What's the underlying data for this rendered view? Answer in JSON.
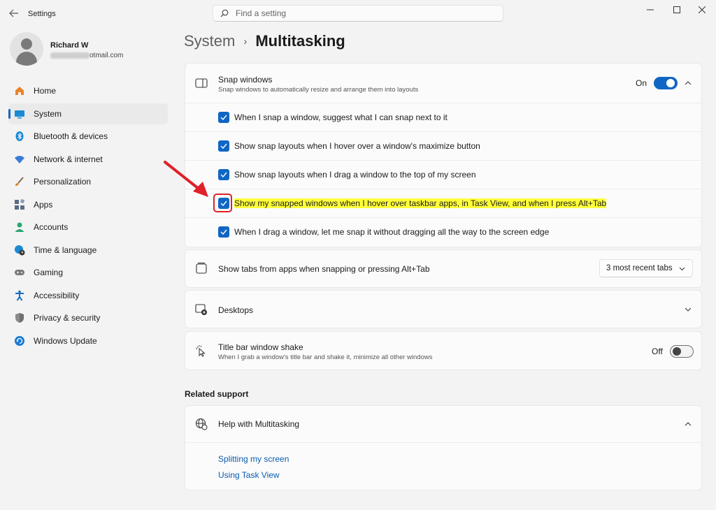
{
  "window": {
    "title": "Settings",
    "back_icon": "back-arrow-icon",
    "controls": [
      "minimize-icon",
      "maximize-icon",
      "close-icon"
    ]
  },
  "search": {
    "placeholder": "Find a setting"
  },
  "profile": {
    "name": "Richard W",
    "email_visible": "otmail.com"
  },
  "sidebar": {
    "items": [
      {
        "label": "Home",
        "icon": "home-icon",
        "color": "#e8832a"
      },
      {
        "label": "System",
        "icon": "system-icon",
        "color": "#1a8ad4",
        "active": true
      },
      {
        "label": "Bluetooth & devices",
        "icon": "bluetooth-icon",
        "color": "#1a8ad4"
      },
      {
        "label": "Network & internet",
        "icon": "wifi-icon",
        "color": "#3a7bd5"
      },
      {
        "label": "Personalization",
        "icon": "brush-icon",
        "color": "#d8822c"
      },
      {
        "label": "Apps",
        "icon": "apps-icon",
        "color": "#5b6b86"
      },
      {
        "label": "Accounts",
        "icon": "accounts-icon",
        "color": "#2aa56f"
      },
      {
        "label": "Time & language",
        "icon": "globe-clock-icon",
        "color": "#1a8ad4"
      },
      {
        "label": "Gaming",
        "icon": "gamepad-icon",
        "color": "#7a7a7a"
      },
      {
        "label": "Accessibility",
        "icon": "accessibility-icon",
        "color": "#1a6fc4"
      },
      {
        "label": "Privacy & security",
        "icon": "shield-icon",
        "color": "#8a8a8a"
      },
      {
        "label": "Windows Update",
        "icon": "update-icon",
        "color": "#1a7ad4"
      }
    ]
  },
  "header": {
    "parent": "System",
    "separator": "›",
    "current": "Multitasking"
  },
  "snap": {
    "title": "Snap windows",
    "subtitle": "Snap windows to automatically resize and arrange them into layouts",
    "toggle_label": "On",
    "toggle_on": true,
    "options": [
      {
        "label": "When I snap a window, suggest what I can snap next to it",
        "checked": true
      },
      {
        "label": "Show snap layouts when I hover over a window's maximize button",
        "checked": true
      },
      {
        "label": "Show snap layouts when I drag a window to the top of my screen",
        "checked": true
      },
      {
        "label": "Show my snapped windows when I hover over taskbar apps, in Task View, and when I press Alt+Tab",
        "checked": true,
        "highlighted": true
      },
      {
        "label": "When I drag a window, let me snap it without dragging all the way to the screen edge",
        "checked": true
      }
    ]
  },
  "tabs_setting": {
    "title": "Show tabs from apps when snapping or pressing Alt+Tab",
    "selected": "3 most recent tabs"
  },
  "desktops": {
    "title": "Desktops"
  },
  "shake": {
    "title": "Title bar window shake",
    "subtitle": "When I grab a window's title bar and shake it, minimize all other windows",
    "toggle_label": "Off",
    "toggle_on": false
  },
  "related": {
    "section_title": "Related support",
    "help_title": "Help with Multitasking",
    "links": [
      "Splitting my screen",
      "Using Task View"
    ]
  },
  "colors": {
    "accent": "#1066c4",
    "highlight": "#ffff3a",
    "annotation": "#e0202a"
  }
}
